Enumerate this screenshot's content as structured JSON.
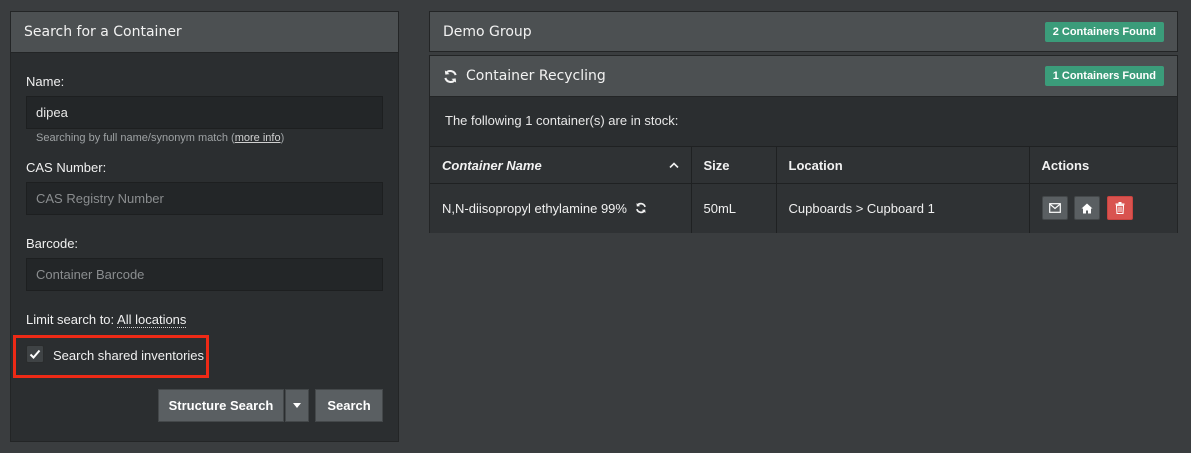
{
  "search_panel": {
    "title": "Search for a Container",
    "name_label": "Name:",
    "name_value": "dipea",
    "name_help_prefix": "Searching by full name/synonym match (",
    "name_help_link": "more info",
    "name_help_suffix": ")",
    "cas_label": "CAS Number:",
    "cas_placeholder": "CAS Registry Number",
    "barcode_label": "Barcode:",
    "barcode_placeholder": "Container Barcode",
    "limit_prefix": "Limit search to: ",
    "limit_link": "All locations",
    "shared_label": "Search shared inventories",
    "shared_checked": true,
    "structure_search_label": "Structure Search",
    "search_label": "Search"
  },
  "groups": [
    {
      "title": "Demo Group",
      "badge": "2 Containers Found"
    }
  ],
  "recycling": {
    "title": "Container Recycling",
    "badge": "1 Containers Found",
    "stock_text": "The following 1 container(s) are in stock:",
    "columns": [
      "Container Name",
      "Size",
      "Location",
      "Actions"
    ],
    "rows": [
      {
        "name": "N,N-diisopropyl ethylamine 99%",
        "size": "50mL",
        "location": "Cupboards > Cupboard 1"
      }
    ]
  },
  "colors": {
    "background": "#3a3d3f",
    "panel": "#2b2e30",
    "heading": "#4c5052",
    "badge": "#3b9c7a",
    "danger": "#d9534f",
    "highlight": "#ee2a16"
  }
}
